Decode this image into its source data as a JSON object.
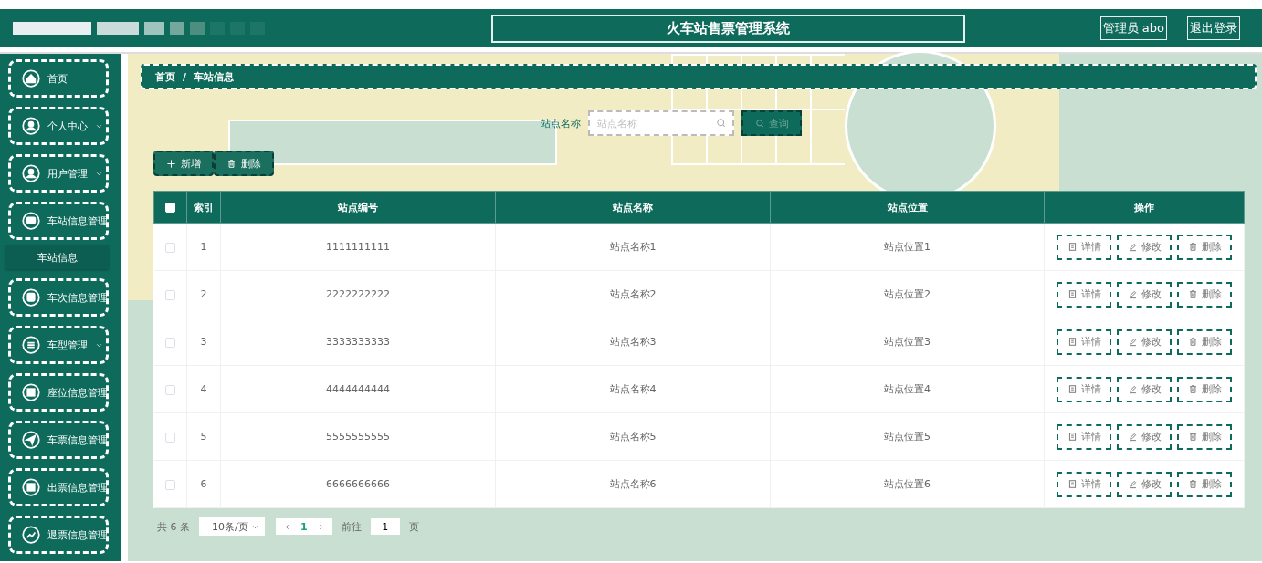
{
  "header": {
    "title": "火车站售票管理系统",
    "user": "管理员 abo",
    "logout": "退出登录"
  },
  "sidebar": {
    "items": [
      {
        "label": "首页"
      },
      {
        "label": "个人中心",
        "expanded": false
      },
      {
        "label": "用户管理",
        "expanded": false
      },
      {
        "label": "车站信息管理",
        "expanded": true,
        "children": [
          {
            "label": "车站信息",
            "selected": true
          }
        ]
      },
      {
        "label": "车次信息管理"
      },
      {
        "label": "车型管理",
        "expanded": false
      },
      {
        "label": "座位信息管理"
      },
      {
        "label": "车票信息管理"
      },
      {
        "label": "出票信息管理"
      },
      {
        "label": "退票信息管理"
      }
    ]
  },
  "breadcrumb": [
    "首页",
    "车站信息"
  ],
  "breadcrumb_separator": "/",
  "search": {
    "label": "站点名称",
    "placeholder": "站点名称",
    "button": "查询"
  },
  "toolbar": {
    "add": "新增",
    "delete": "删除"
  },
  "table": {
    "header_checked": false,
    "columns": [
      "索引",
      "站点编号",
      "站点名称",
      "站点位置",
      "操作"
    ],
    "rows": [
      {
        "checked": false,
        "cells": [
          "1",
          "1111111111",
          "站点名称1",
          "站点位置1"
        ],
        "actions": [
          "详情",
          "修改",
          "删除"
        ]
      },
      {
        "checked": false,
        "cells": [
          "2",
          "2222222222",
          "站点名称2",
          "站点位置2"
        ],
        "actions": [
          "详情",
          "修改",
          "删除"
        ]
      },
      {
        "checked": false,
        "cells": [
          "3",
          "3333333333",
          "站点名称3",
          "站点位置3"
        ],
        "actions": [
          "详情",
          "修改",
          "删除"
        ]
      },
      {
        "checked": false,
        "cells": [
          "4",
          "4444444444",
          "站点名称4",
          "站点位置4"
        ],
        "actions": [
          "详情",
          "修改",
          "删除"
        ]
      },
      {
        "checked": false,
        "cells": [
          "5",
          "5555555555",
          "站点名称5",
          "站点位置5"
        ],
        "actions": [
          "详情",
          "修改",
          "删除"
        ]
      },
      {
        "checked": false,
        "cells": [
          "6",
          "6666666666",
          "站点名称6",
          "站点位置6"
        ],
        "actions": [
          "详情",
          "修改",
          "删除"
        ]
      }
    ]
  },
  "pagination": {
    "total": "共 6 条",
    "page_size": "10条/页",
    "pages": [
      {
        "label": "1",
        "selected": true
      }
    ],
    "goto_label": "前往",
    "goto_value": "1",
    "goto_suffix": "页"
  }
}
